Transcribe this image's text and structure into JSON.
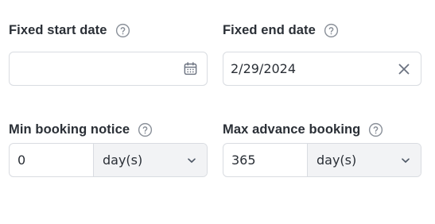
{
  "fixed_start": {
    "label": "Fixed start date",
    "value": "",
    "icon": "calendar-icon"
  },
  "fixed_end": {
    "label": "Fixed end date",
    "value": "2/29/2024",
    "icon": "clear-x-icon"
  },
  "min_notice": {
    "label": "Min booking notice",
    "value": "0",
    "unit": "day(s)"
  },
  "max_advance": {
    "label": "Max advance booking",
    "value": "365",
    "unit": "day(s)"
  },
  "colors": {
    "border": "#d9dce1",
    "select_bg": "#f2f3f5",
    "icon": "#6b7280"
  }
}
